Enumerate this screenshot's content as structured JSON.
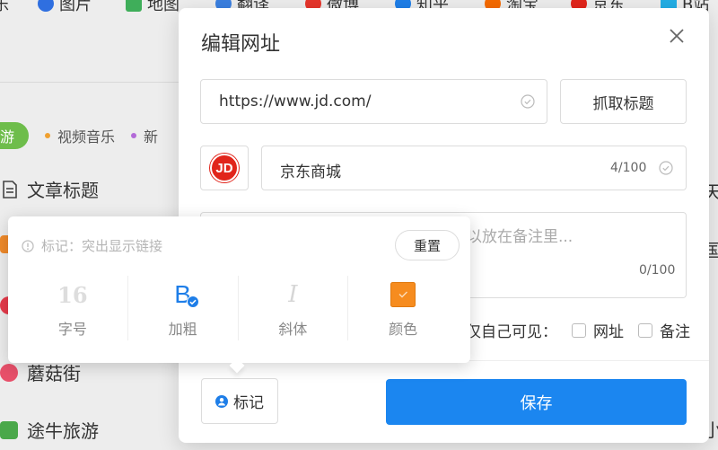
{
  "background": {
    "bookmarks": [
      "乐",
      "图片",
      "地图",
      "翻译",
      "微博",
      "知乎",
      "淘宝",
      "京东",
      "B站"
    ],
    "tabs": {
      "active": "游",
      "items": [
        "视频音乐",
        "新"
      ]
    },
    "section_title": "文章标题",
    "sites": [
      "蘑菇街",
      "途牛旅游"
    ],
    "right_chars": [
      "天",
      "国",
      "小"
    ],
    "colors": {
      "active_tab": "#6ebd4b"
    }
  },
  "dialog": {
    "title": "编辑网址",
    "url_value": "https://www.jd.com/",
    "fetch_button": "抓取标题",
    "site_logo_text": "JD",
    "name_value": "京东商城",
    "name_counter": "4/100",
    "note_placeholder": "以放在备注里...",
    "note_counter": "0/100",
    "visibility_label": "仅自己可见：",
    "visibility_options": [
      {
        "label": "网址",
        "checked": false
      },
      {
        "label": "备注",
        "checked": false
      }
    ],
    "mark_button": "标记",
    "save_button": "保存",
    "colors": {
      "primary": "#1b86f0",
      "jd_red": "#e1251b"
    }
  },
  "popup": {
    "hint": "标记：突出显示链接",
    "reset_button": "重置",
    "options": [
      {
        "glyph": "16",
        "label": "字号",
        "active": false
      },
      {
        "glyph": "B",
        "label": "加粗",
        "active": true
      },
      {
        "glyph": "I",
        "label": "斜体",
        "active": false
      },
      {
        "glyph": "",
        "label": "颜色",
        "active": false
      }
    ],
    "colors": {
      "active": "#1e7ee8",
      "color_swatch": "#f68c1f"
    }
  }
}
